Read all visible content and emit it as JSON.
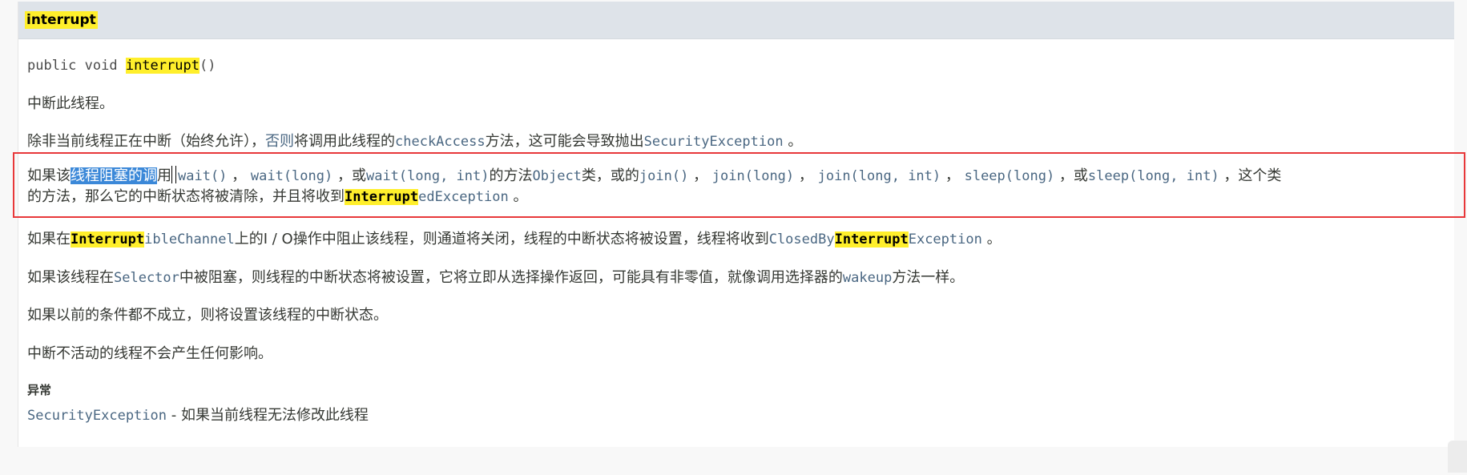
{
  "header": {
    "title": "interrupt"
  },
  "signature": {
    "prefix": "public void ",
    "method": "interrupt",
    "suffix": "()"
  },
  "p1": "中断此线程。",
  "p2": {
    "a": "除非当前线程正在中断（始终允许），",
    "b": "否则",
    "c": "将调用此线程的",
    "d": "checkAccess",
    "e": "方法，这可能会导致抛出",
    "f": "SecurityException",
    "g": " 。"
  },
  "p3": {
    "a": "如果该",
    "selected": "线程阻塞的调",
    "b": "用",
    "c": "wait()",
    "d": " ， ",
    "e": "wait(long)",
    "f": " ，或",
    "g": "wait(long, int)",
    "h": "的方法",
    "i": "Object",
    "j": "类，或的",
    "k": "join()",
    "l": " ， ",
    "m": "join(long)",
    "n": " ， ",
    "o": "join(long, int)",
    "p": " ， ",
    "q": "sleep(long)",
    "r": " ，或",
    "s": "sleep(long, int)",
    "t": " ，这个类",
    "u": "的方法，那么它的中断状态将被清除，并且将收到",
    "v": "Interrupt",
    "w": "edException",
    "x": " 。"
  },
  "p4": {
    "a": "如果在",
    "b": "Interrupt",
    "c": "ibleChannel",
    "d": "上的I / O操作中阻止该线程，则通道将关闭，线程的中断状态将被设置，线程将收到",
    "e": "ClosedBy",
    "f": "Interrupt",
    "g": "Exception",
    "h": " 。"
  },
  "p5": {
    "a": "如果该线程在",
    "b": "Selector",
    "c": "中被阻塞，则线程的中断状态将被设置，它将立即从选择操作返回，可能具有非零值，就像调用选择器的",
    "d": "wakeup",
    "e": "方法一样。"
  },
  "p6": "如果以前的条件都不成立，则将设置该线程的中断状态。",
  "p7": "中断不活动的线程不会产生任何影响。",
  "exceptions": {
    "heading": "异常",
    "name": "SecurityException",
    "desc": " - 如果当前线程无法修改此线程"
  }
}
